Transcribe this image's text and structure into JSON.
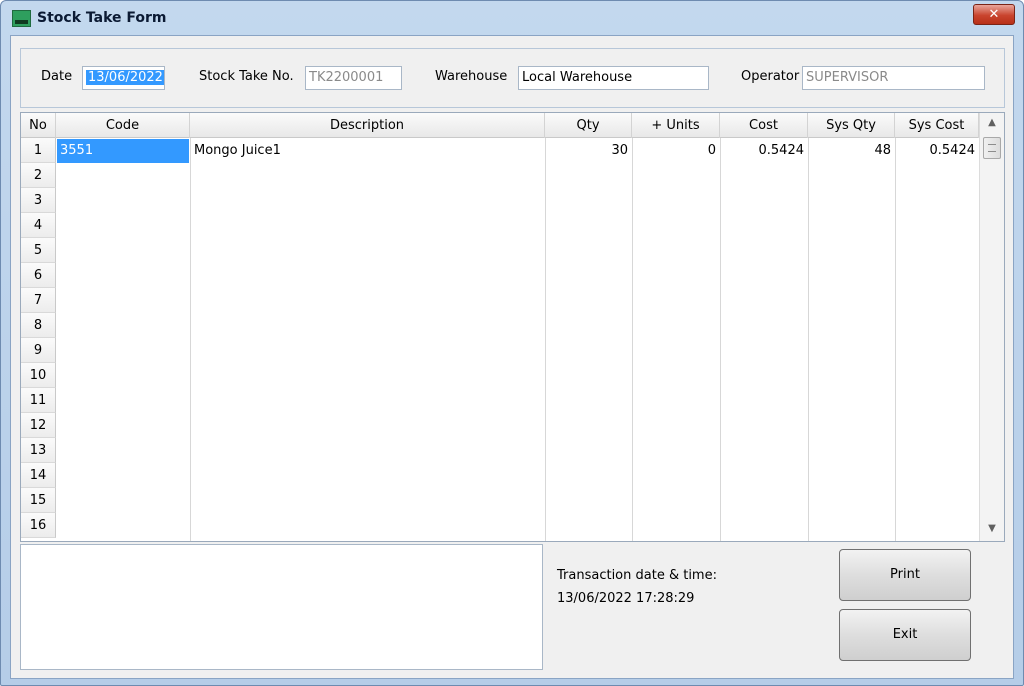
{
  "window": {
    "title": "Stock Take Form",
    "close_label": "✕",
    "icon": "app-logo-icon"
  },
  "header": {
    "date_label": "Date",
    "date_value": "13/06/2022",
    "stock_take_no_label": "Stock Take No.",
    "stock_take_no_value": "TK2200001",
    "warehouse_label": "Warehouse",
    "warehouse_value": "Local Warehouse",
    "operator_label": "Operator",
    "operator_value": "SUPERVISOR"
  },
  "grid": {
    "columns": [
      "No",
      "Code",
      "Description",
      "Qty",
      "+ Units",
      "Cost",
      "Sys Qty",
      "Sys Cost"
    ],
    "rows": [
      {
        "no": "1",
        "code": "3551",
        "description": "Mongo Juice1",
        "qty": "30",
        "units": "0",
        "cost": "0.5424",
        "sys_qty": "48",
        "sys_cost": "0.5424"
      },
      {
        "no": "2"
      },
      {
        "no": "3"
      },
      {
        "no": "4"
      },
      {
        "no": "5"
      },
      {
        "no": "6"
      },
      {
        "no": "7"
      },
      {
        "no": "8"
      },
      {
        "no": "9"
      },
      {
        "no": "10"
      },
      {
        "no": "11"
      },
      {
        "no": "12"
      },
      {
        "no": "13"
      },
      {
        "no": "14"
      },
      {
        "no": "15"
      },
      {
        "no": "16"
      }
    ]
  },
  "footer": {
    "transaction_label": "Transaction date & time:",
    "transaction_value": "13/06/2022 17:28:29",
    "print_label": "Print",
    "exit_label": "Exit"
  },
  "colors": {
    "selection": "#3399ff",
    "title_bar": "#c3d8ee",
    "close_button": "#c9442e"
  }
}
